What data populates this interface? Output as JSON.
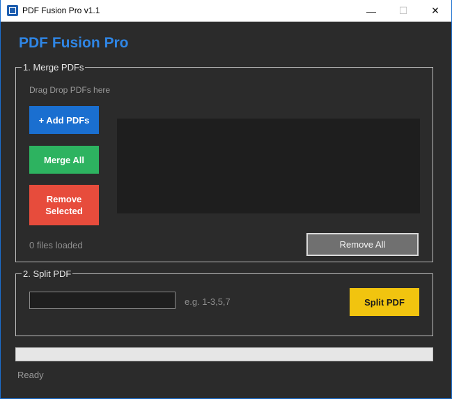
{
  "window": {
    "title": "PDF Fusion Pro v1.1",
    "controls": {
      "minimize": "—",
      "maximize": "☐",
      "close": "✕"
    }
  },
  "header": {
    "title": "PDF Fusion Pro"
  },
  "merge": {
    "group_label": "1. Merge PDFs",
    "drop_hint": "Drag  Drop PDFs here",
    "add_button": "+ Add PDFs",
    "merge_button": "Merge All",
    "remove_button": "Remove Selected",
    "files": [],
    "file_count": "0 files loaded",
    "remove_all_button": "Remove All"
  },
  "split": {
    "group_label": "2. Split PDF",
    "pages_value": "",
    "pages_hint": "e.g. 1-3,5,7",
    "split_button": "Split PDF"
  },
  "progress": {
    "value": 0
  },
  "status": {
    "text": "Ready"
  },
  "colors": {
    "accent": "#2f86e6",
    "add": "#1a6fd0",
    "merge": "#2db360",
    "remove": "#e74c3c",
    "split": "#f1c40f",
    "background": "#2b2b2b"
  }
}
